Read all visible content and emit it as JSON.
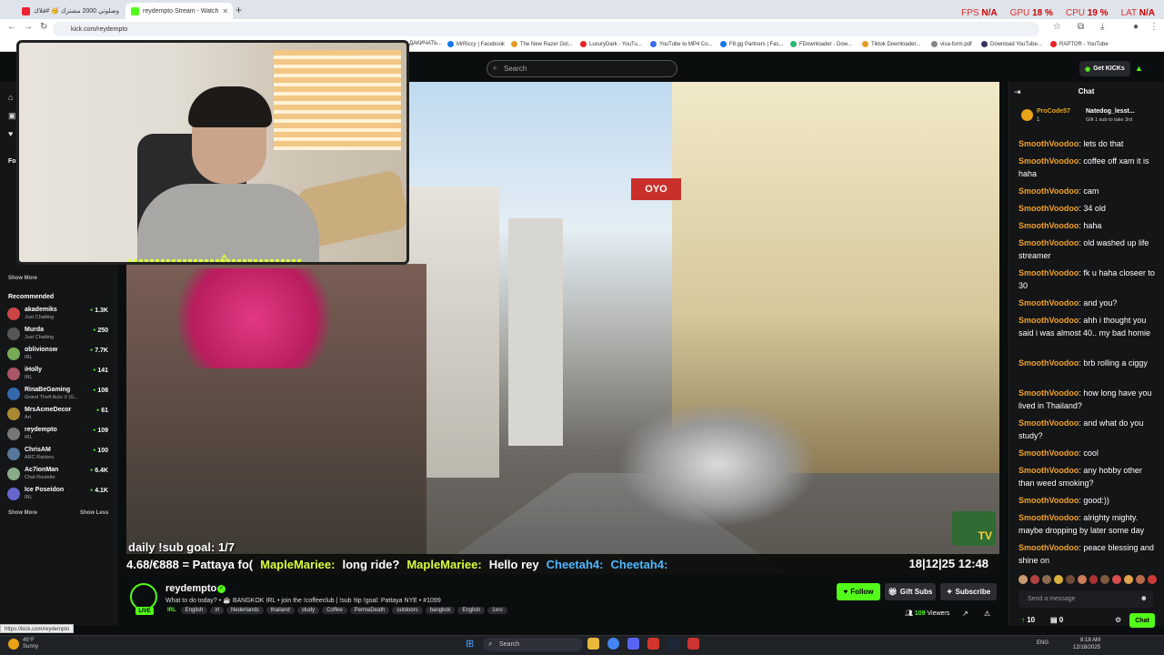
{
  "browser": {
    "tabs": [
      {
        "label": "وصلوتي 2000 مشترك 🥳 #فلاك",
        "active": false
      },
      {
        "label": "reydempto Stream - Watch",
        "active": true
      }
    ],
    "url": "kick.com/reydempto",
    "status_url": "https://kick.com/reydempto",
    "perf": {
      "fps_label": "FPS",
      "fps": "N/A",
      "gpu_label": "GPU",
      "gpu": "18 %",
      "cpu_label": "CPU",
      "cpu": "19 %",
      "lat_label": "LAT",
      "lat": "N/A"
    },
    "bookmarks": [
      "ДАКИЧАТЬ...",
      "MrRiccy | Facebook",
      "The New Razer Gol...",
      "LuxuryDark - YouTu...",
      "YouTube to MP4 Co...",
      "F8.gg Partners | Fac...",
      "FDownloader - Dow...",
      "Tiktok Downloader...",
      "visa-form.pdf",
      "Download YouTube...",
      "RAPTOR - YouTube"
    ]
  },
  "topbar": {
    "search_placeholder": "Search",
    "get_kicks": "Get KICKs"
  },
  "sidebar": {
    "following_label": "Fo",
    "show_more_top": "Show More",
    "recommended_title": "Recommended",
    "recommended": [
      {
        "name": "akademiks",
        "category": "Just Chatting",
        "viewers": "1.3K"
      },
      {
        "name": "Murda",
        "category": "Just Chatting",
        "viewers": "250"
      },
      {
        "name": "oblivionsw",
        "category": "IRL",
        "viewers": "7.7K"
      },
      {
        "name": "iHolly",
        "category": "IRL",
        "viewers": "141"
      },
      {
        "name": "RinaBeGaming",
        "category": "Grand Theft Auto V (G...",
        "viewers": "108"
      },
      {
        "name": "MrsAcmeDecor",
        "category": "Art",
        "viewers": "61"
      },
      {
        "name": "reydempto",
        "category": "IRL",
        "viewers": "109"
      },
      {
        "name": "ChrisAM",
        "category": "ARC Raiders",
        "viewers": "100"
      },
      {
        "name": "Ac7ionMan",
        "category": "Chat Roulette",
        "viewers": "6.4K"
      },
      {
        "name": "Ice Poseidon",
        "category": "IRL",
        "viewers": "4.1K"
      }
    ],
    "show_more": "Show More",
    "show_less": "Show Less"
  },
  "video": {
    "sign": "OYO",
    "sub_goal": "daily !sub goal: 1/7",
    "ticker": [
      {
        "text": "4.68/€888 = Pattaya fo(",
        "kind": "plain"
      },
      {
        "text": "MapleMariee:",
        "kind": "name"
      },
      {
        "text": "long ride?",
        "kind": "plain"
      },
      {
        "text": "MapleMariee:",
        "kind": "name"
      },
      {
        "text": "Hello rey",
        "kind": "plain"
      },
      {
        "text": "Cheetah4:",
        "kind": "name2"
      },
      {
        "text": "Cheetah4:",
        "kind": "name2"
      }
    ],
    "clock": "18|12|25 12:48",
    "tv_badge": "TV"
  },
  "channel": {
    "name": "reydempto",
    "live": "LIVE",
    "title": "What to do today? • ☕ BANGKOK IRL • join the !coffeeclub | !sub !tip !goal: Pattaya NYE • #1099",
    "category": "IRL",
    "tags": [
      "English",
      "irl",
      "Nederlands",
      "thailand",
      "study",
      "Coffee",
      "PermaDeath",
      "outdoors",
      "bangkok",
      "English",
      "1xro"
    ],
    "follow": "Follow",
    "gift_subs": "Gift Subs",
    "subscribe": "Subscribe",
    "viewers_count": "109",
    "viewers_label": "Viewers"
  },
  "chat": {
    "title": "Chat",
    "pinned": [
      {
        "user": "ProCode57",
        "count": "1"
      },
      {
        "user": "Natedog_lesst...",
        "note": "Gift 1 sub to take 3rd"
      }
    ],
    "messages": [
      {
        "user": "SmoothVoodoo",
        "text": "lets do that"
      },
      {
        "user": "SmoothVoodoo",
        "text": "coffee off xam it is haha"
      },
      {
        "user": "SmoothVoodoo",
        "text": "cam"
      },
      {
        "user": "SmoothVoodoo",
        "text": "34 old"
      },
      {
        "user": "SmoothVoodoo",
        "text": "haha"
      },
      {
        "user": "SmoothVoodoo",
        "text": "old washed up life streamer"
      },
      {
        "user": "SmoothVoodoo",
        "text": "fk u haha closeer to 30"
      },
      {
        "user": "SmoothVoodoo",
        "text": "and you?"
      },
      {
        "user": "SmoothVoodoo",
        "text": "ahh i thought you said i was almost 40.. my bad homie"
      },
      {
        "user": "SmoothVoodoo",
        "text": "brb rolling a ciggy"
      },
      {
        "user": "SmoothVoodoo",
        "text": "how long have you lived in Thailand?"
      },
      {
        "user": "SmoothVoodoo",
        "text": "and what do you study?"
      },
      {
        "user": "SmoothVoodoo",
        "text": "cool"
      },
      {
        "user": "SmoothVoodoo",
        "text": "any hobby other than weed smoking?"
      },
      {
        "user": "SmoothVoodoo",
        "text": "good:))"
      },
      {
        "user": "SmoothVoodoo",
        "text": "alrighty mighty. maybe dropping by later some day"
      },
      {
        "user": "SmoothVoodoo",
        "text": "peace blessing and shine on"
      }
    ],
    "input_placeholder": "Send a message",
    "kicks_count": "10",
    "gifts_count": "0",
    "send_label": "Chat"
  },
  "taskbar": {
    "weather_temp": "45°F",
    "weather_desc": "Sunny",
    "search": "Search",
    "lang": "ENG",
    "time": "8:18 AM",
    "date": "12/18/2025"
  }
}
